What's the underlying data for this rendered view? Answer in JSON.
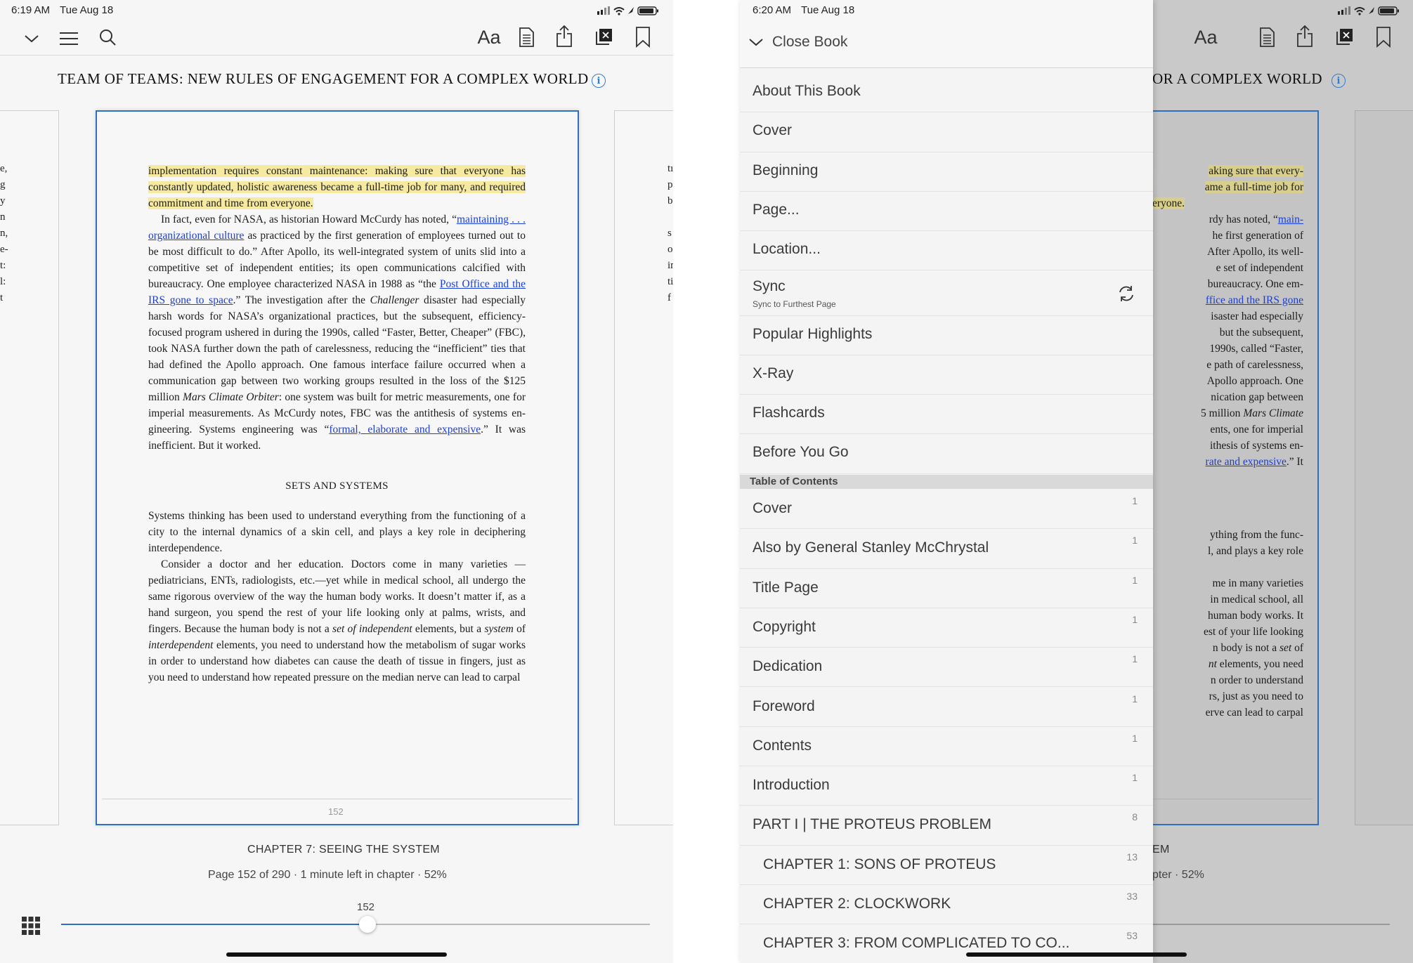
{
  "left": {
    "status": {
      "time": "6:19 AM",
      "date": "Tue Aug 18"
    },
    "toolbar_icons": [
      "chevron-down-icon",
      "menu-icon",
      "search-icon",
      "font-settings-icon",
      "notebook-icon",
      "share-icon",
      "xray-icon",
      "bookmark-icon"
    ],
    "font_label": "Aa",
    "book_title": "TEAM OF TEAMS: NEW RULES OF ENGAGEMENT FOR A COMPLEX WORLD",
    "page": {
      "p1": "implementation requires constant maintenance: making sure that every­one has constantly updated, holistic awareness became a full-time job for many, and required commitment and time from everyone.",
      "p2a": "In fact, even for NASA, as historian Howard McCurdy has noted, “",
      "p2_link1": "main­taining . . . organizational culture",
      "p2b": " as practiced by the first generation of employees turned out to be most difficult to do.” After Apollo, its well-integrated system of units slid into a competitive set of independent entities; its open communications calcified with bureaucracy. One em­ployee characterized NASA in 1988 as “the ",
      "p2_link2": "Post Office and the IRS gone to space",
      "p2c": ".” The investigation after the ",
      "p2_it1": "Challenger",
      "p2d": " disaster had especially harsh words for NASA’s organizational practices, but the subsequent, efficiency-focused program ushered in during the 1990s, called “Faster, Better, Cheaper” (FBC), took NASA further down the path of carelessness, reducing the “inefficient” ties that had defined the Apollo approach. One famous interface failure occurred when a communication gap between two working groups resulted in the loss of the $125 million ",
      "p2_it2": "Mars Climate Orbiter",
      "p2e": ": one system was built for metric measurements, one for imperial measurements. As McCurdy notes, FBC was the antithesis of systems en­gineering. Systems engineering was “",
      "p2_link3": "formal, elaborate and expensive",
      "p2f": ".” It was inefficient. But it worked.",
      "section": "SETS AND SYSTEMS",
      "p3": "Systems thinking has been used to understand everything from the func­tioning of a city to the internal dynamics of a skin cell, and plays a key role in deciphering interdependence.",
      "p4a": "Consider a doctor and her education. Doctors come in many varieties —pediatricians, ENTs, radiologists, etc.—yet while in medical school, all undergo the same rigorous overview of the way the human body works. It doesn’t matter if, as a hand surgeon, you spend the rest of your life looking only at palms, wrists, and fingers. Because the human body is not a ",
      "p4_it1": "set of independent",
      "p4b": " elements, but a ",
      "p4_it2": "system",
      "p4c": " of ",
      "p4_it3": "interdependent",
      "p4d": " elements, you need to understand how the metabolism of sugar works in order to understand how diabetes can cause the death of tissue in fingers, just as you need to understand how repeated pressure on the median nerve can lead to carpal",
      "number": "152"
    },
    "chapter": "CHAPTER 7: SEEING THE SYSTEM",
    "progress": "Page 152 of 290 · 1 minute left in chapter · 52%",
    "slider": {
      "label": "152",
      "fraction": 0.52
    },
    "edge_left": "e,\ng\ny\nn\nn,\ne-\nt:\nl:\nt",
    "edge_right": "tı\np\nb\n\ns\no\nin\nti\nf",
    "colors": {
      "accent": "#2f6fbd",
      "highlight": "#f6e9a0",
      "link": "#1b3fd4"
    }
  },
  "right": {
    "status": {
      "time": "6:20 AM",
      "date": "Tue Aug 18"
    },
    "book_title_fragment": "OR A COMPLEX WORLD",
    "chapter_fragment": "EM",
    "progress_fragment": "pter · 52%",
    "page_fragment": {
      "l1": "aking sure that every-",
      "l2": "ame a full-time job for",
      "l3": "eryone.",
      "l4a": "rdy has noted, “",
      "l4link": "main-",
      "l5": "he first generation of",
      "l6": "After Apollo, its well-",
      "l7": "e set of independent",
      "l8": "bureaucracy. One em-",
      "l9link": "ffice and the IRS gone",
      "l10": "isaster had especially",
      "l11": "but the subsequent,",
      "l12": "1990s, called “Faster,",
      "l13": "e path of carelessness,",
      "l14": "Apollo approach. One",
      "l15": "nication gap between",
      "l16a": "5 million ",
      "l16it": "Mars Climate",
      "l17": "ents, one for imperial",
      "l18": "ithesis of systems en-",
      "l19link": "rate and expensive",
      "l19b": ".” It",
      "l20": "ything from the func-",
      "l21": "l, and plays a key role",
      "l22": "me in many varieties",
      "l23": "in medical school, all",
      "l24": "human body works. It",
      "l25": "est of your life looking",
      "l26a": "n body is not a ",
      "l26it": "set",
      "l26b": " of",
      "l27it": "nt",
      "l27b": " elements, you need",
      "l28": "n order to understand",
      "l29": "rs, just as you need to",
      "l30": "erve can lead to carpal"
    },
    "menu": {
      "close_label": "Close Book",
      "items": [
        {
          "label": "About This Book"
        },
        {
          "label": "Cover"
        },
        {
          "label": "Beginning"
        },
        {
          "label": "Page..."
        },
        {
          "label": "Location..."
        },
        {
          "label": "Sync",
          "sub": "Sync to Furthest Page"
        },
        {
          "label": "Popular Highlights"
        },
        {
          "label": "X-Ray"
        },
        {
          "label": "Flashcards"
        },
        {
          "label": "Before You Go"
        }
      ],
      "toc_header": "Table of Contents",
      "toc": [
        {
          "label": "Cover",
          "page": "1"
        },
        {
          "label": "Also by General Stanley McChrystal",
          "page": "1"
        },
        {
          "label": "Title Page",
          "page": "1"
        },
        {
          "label": "Copyright",
          "page": "1"
        },
        {
          "label": "Dedication",
          "page": "1"
        },
        {
          "label": "Foreword",
          "page": "1"
        },
        {
          "label": "Contents",
          "page": "1"
        },
        {
          "label": "Introduction",
          "page": "1"
        },
        {
          "label": "PART I | THE PROTEUS PROBLEM",
          "page": "8"
        },
        {
          "label": "CHAPTER 1: SONS OF PROTEUS",
          "page": "13"
        },
        {
          "label": "CHAPTER 2: CLOCKWORK",
          "page": "33"
        },
        {
          "label": "CHAPTER 3: FROM COMPLICATED TO CO...",
          "page": "53"
        }
      ]
    }
  }
}
